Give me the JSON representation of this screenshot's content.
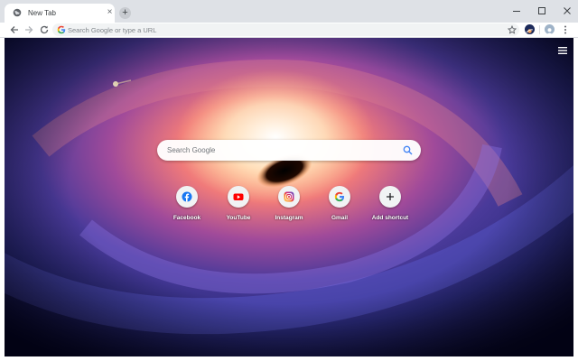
{
  "browser": {
    "tab": {
      "title": "New Tab",
      "favicon": "globe-icon",
      "close": "×"
    },
    "new_tab_symbol": "+",
    "omnibox": {
      "placeholder": "Search Google or type a URL"
    },
    "icons": {
      "back": "arrow-left-icon",
      "forward": "arrow-right-icon",
      "reload": "reload-icon",
      "star": "star-icon",
      "extension": "extension-icon",
      "profile": "profile-avatar-icon",
      "menu": "kebab-menu-icon"
    }
  },
  "new_tab_page": {
    "search": {
      "placeholder": "Search Google",
      "icon": "magnifier-icon",
      "icon_color": "#4285f4"
    },
    "page_menu_icon": "hamburger-menu-icon",
    "shortcuts": [
      {
        "label": "Facebook",
        "icon": "facebook-icon",
        "color": "#1877f2"
      },
      {
        "label": "YouTube",
        "icon": "youtube-icon",
        "color": "#ff0000"
      },
      {
        "label": "Instagram",
        "icon": "instagram-icon",
        "color": "#c13584"
      },
      {
        "label": "Gmail",
        "icon": "google-g-icon",
        "color": "#4285f4"
      },
      {
        "label": "Add shortcut",
        "icon": "plus-icon",
        "symbol": "+",
        "color": "#202124"
      }
    ]
  }
}
